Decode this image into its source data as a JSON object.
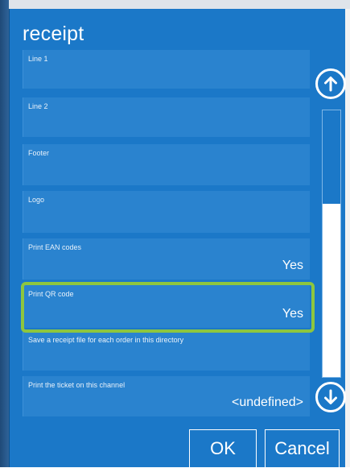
{
  "dialog": {
    "title": "receipt"
  },
  "fields": [
    {
      "label": "Line 1",
      "value": ""
    },
    {
      "label": "Line 2",
      "value": ""
    },
    {
      "label": "Footer",
      "value": ""
    },
    {
      "label": "Logo",
      "value": ""
    },
    {
      "label": "Print EAN codes",
      "value": "Yes"
    },
    {
      "label": "Print QR code",
      "value": "Yes"
    },
    {
      "label": "Save a receipt file for each order in this directory",
      "value": ""
    },
    {
      "label": "Print the ticket on this channel",
      "value": "<undefined>"
    }
  ],
  "scroll": {
    "up_icon": "arrow-up-circle-icon",
    "down_icon": "arrow-down-circle-icon",
    "thumb_start_fraction": 0.35,
    "thumb_end_fraction": 1.0
  },
  "buttons": {
    "ok_label": "OK",
    "cancel_label": "Cancel"
  },
  "colors": {
    "dialog_background": "#1b78c8",
    "field_background": "#2a83cf",
    "highlight": "#8dc63f",
    "text": "#ffffff"
  }
}
